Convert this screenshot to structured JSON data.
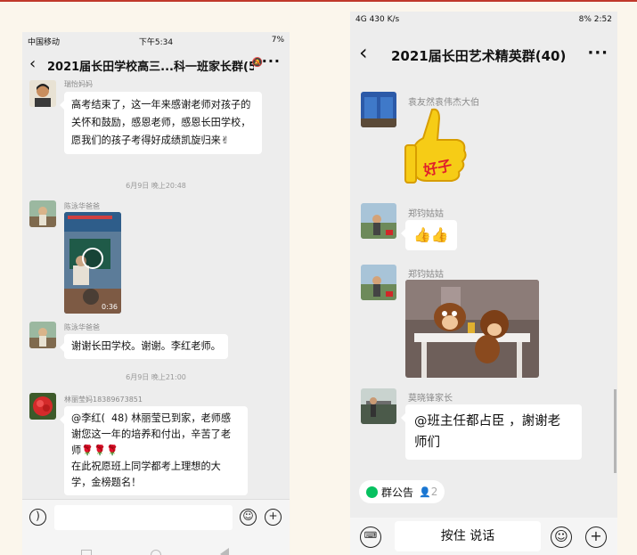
{
  "left_phone": {
    "status_bar": {
      "carrier": "中国移动",
      "time": "下午5:34",
      "battery": "7%"
    },
    "title": "2021届长田学校高三...科一班家长群(52)",
    "messages": [
      {
        "sender": "瑞怡妈妈",
        "text": "高考结束了，这一年来感谢老师对孩子的关怀和鼓励，感恩老师，感恩长田学校，愿我们的孩子考得好成绩凯旋归来✌"
      },
      {
        "timestamp": "6月9日 晚上20:48"
      },
      {
        "sender": "陈泳华爸爸",
        "video_duration": "0:36"
      },
      {
        "sender": "陈泳华爸爸",
        "text": "谢谢长田学校。谢谢。李红老师。"
      },
      {
        "timestamp": "6月9日 晚上21:00"
      },
      {
        "sender": "林丽莹妈18389673851",
        "text": "@李红(  48) 林丽莹已到家，老师感谢您这一年的培养和付出，辛苦了老师🌹🌹🌹\n在此祝愿班上同学都考上理想的大学，金榜题名！"
      }
    ],
    "input": {
      "placeholder": ""
    }
  },
  "right_phone": {
    "status_bar": {
      "signal": "4G",
      "speed": "430 K/s",
      "battery": "8%",
      "time": "2:52"
    },
    "title": "2021届长田艺术精英群(40)",
    "messages": [
      {
        "sender": "袁友然袁伟杰大伯",
        "sticker": "👍好了"
      },
      {
        "sender": "郑钧姑姑",
        "text": "👍👍"
      },
      {
        "sender": "郑钧姑姑",
        "image": "cartoon"
      },
      {
        "sender": "莫晓锋家长",
        "text": "@班主任都占臣 ，謝谢老师们"
      }
    ],
    "announcement": {
      "label": "群公告",
      "count": "2"
    },
    "hold_to_talk": "按住 说话"
  },
  "colors": {
    "page_bg": "#fbf6ec",
    "chat_bg": "#ededed",
    "bubble": "#ffffff",
    "accent_green": "#07c160"
  }
}
